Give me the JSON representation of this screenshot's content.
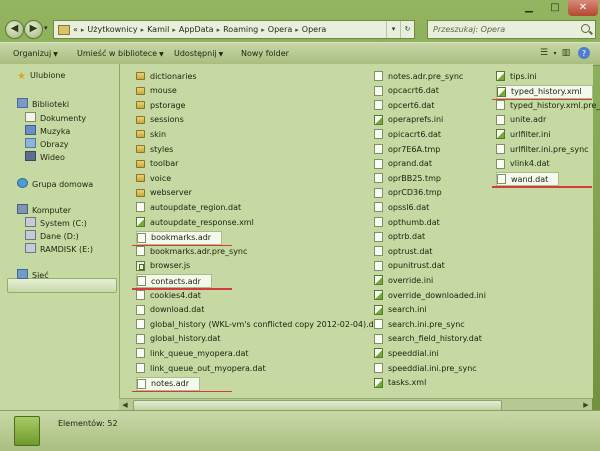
{
  "window_controls": {
    "minimize": "▁",
    "maximize": "□",
    "close": "✕"
  },
  "nav": {
    "back": "◀",
    "forward": "▶",
    "history": "▾"
  },
  "address": {
    "prefix": "«",
    "crumbs": [
      "Użytkownicy",
      "Kamil",
      "AppData",
      "Roaming",
      "Opera",
      "Opera"
    ],
    "separator": "▸",
    "dropdown": "▾",
    "refresh": "↻"
  },
  "search": {
    "placeholder": "Przeszukaj: Opera"
  },
  "toolbar": {
    "organize": "Organizuj",
    "add_to_library": "Umieść w bibliotece",
    "share": "Udostępnij",
    "new_folder": "Nowy folder",
    "view_icon": "☰",
    "view_menu": "▾",
    "pane_icon": "▥",
    "help": "?",
    "caret": "▼"
  },
  "sidebar": {
    "favorites": "Ulubione",
    "libraries": "Biblioteki",
    "lib_items": [
      "Dokumenty",
      "Muzyka",
      "Obrazy",
      "Wideo"
    ],
    "homegroup": "Grupa domowa",
    "computer": "Komputer",
    "drives": [
      "System (C:)",
      "Dane (D:)",
      "RAMDISK (E:)"
    ],
    "network": "Sieć"
  },
  "files": {
    "col1": [
      {
        "name": "dictionaries",
        "icon": "folder"
      },
      {
        "name": "mouse",
        "icon": "folder"
      },
      {
        "name": "pstorage",
        "icon": "folder"
      },
      {
        "name": "sessions",
        "icon": "folder"
      },
      {
        "name": "skin",
        "icon": "folder"
      },
      {
        "name": "styles",
        "icon": "folder"
      },
      {
        "name": "toolbar",
        "icon": "folder"
      },
      {
        "name": "voice",
        "icon": "folder"
      },
      {
        "name": "webserver",
        "icon": "folder"
      },
      {
        "name": "autoupdate_region.dat",
        "icon": "file"
      },
      {
        "name": "autoupdate_response.xml",
        "icon": "np"
      },
      {
        "name": "bookmarks.adr",
        "icon": "file",
        "highlight": true
      },
      {
        "name": "bookmarks.adr.pre_sync",
        "icon": "file"
      },
      {
        "name": "browser.js",
        "icon": "js"
      },
      {
        "name": "contacts.adr",
        "icon": "file",
        "highlight": true
      },
      {
        "name": "cookies4.dat",
        "icon": "file"
      },
      {
        "name": "download.dat",
        "icon": "file"
      },
      {
        "name": "global_history (WKL-vm's conflicted copy 2012-02-04).dat",
        "icon": "file"
      },
      {
        "name": "global_history.dat",
        "icon": "file"
      },
      {
        "name": "link_queue_myopera.dat",
        "icon": "file"
      },
      {
        "name": "link_queue_out_myopera.dat",
        "icon": "file"
      },
      {
        "name": "notes.adr",
        "icon": "file",
        "highlight": true
      }
    ],
    "col2": [
      {
        "name": "notes.adr.pre_sync",
        "icon": "file"
      },
      {
        "name": "opcacrt6.dat",
        "icon": "file"
      },
      {
        "name": "opcert6.dat",
        "icon": "file"
      },
      {
        "name": "operaprefs.ini",
        "icon": "np"
      },
      {
        "name": "opicacrt6.dat",
        "icon": "file"
      },
      {
        "name": "opr7E6A.tmp",
        "icon": "file"
      },
      {
        "name": "oprand.dat",
        "icon": "file"
      },
      {
        "name": "oprBB25.tmp",
        "icon": "file"
      },
      {
        "name": "oprCD36.tmp",
        "icon": "file"
      },
      {
        "name": "opssl6.dat",
        "icon": "file"
      },
      {
        "name": "opthumb.dat",
        "icon": "file"
      },
      {
        "name": "optrb.dat",
        "icon": "file"
      },
      {
        "name": "optrust.dat",
        "icon": "file"
      },
      {
        "name": "opunitrust.dat",
        "icon": "file"
      },
      {
        "name": "override.ini",
        "icon": "np"
      },
      {
        "name": "override_downloaded.ini",
        "icon": "np"
      },
      {
        "name": "search.ini",
        "icon": "np"
      },
      {
        "name": "search.ini.pre_sync",
        "icon": "file"
      },
      {
        "name": "search_field_history.dat",
        "icon": "file"
      },
      {
        "name": "speeddial.ini",
        "icon": "np"
      },
      {
        "name": "speeddial.ini.pre_sync",
        "icon": "file"
      },
      {
        "name": "tasks.xml",
        "icon": "np"
      }
    ],
    "col3": [
      {
        "name": "tips.ini",
        "icon": "np"
      },
      {
        "name": "typed_history.xml",
        "icon": "np",
        "highlight": true
      },
      {
        "name": "typed_history.xml.pre_sync",
        "icon": "file"
      },
      {
        "name": "unite.adr",
        "icon": "file"
      },
      {
        "name": "urlfilter.ini",
        "icon": "np"
      },
      {
        "name": "urlfilter.ini.pre_sync",
        "icon": "file"
      },
      {
        "name": "vlink4.dat",
        "icon": "file"
      },
      {
        "name": "wand.dat",
        "icon": "file",
        "highlight": true
      }
    ]
  },
  "scrollbar": {
    "left": "◀",
    "right": "▶"
  },
  "status": {
    "text": "Elementów: 52"
  },
  "colors": {
    "highlight_underline": "#d23c3c",
    "window": "#8bab57"
  }
}
